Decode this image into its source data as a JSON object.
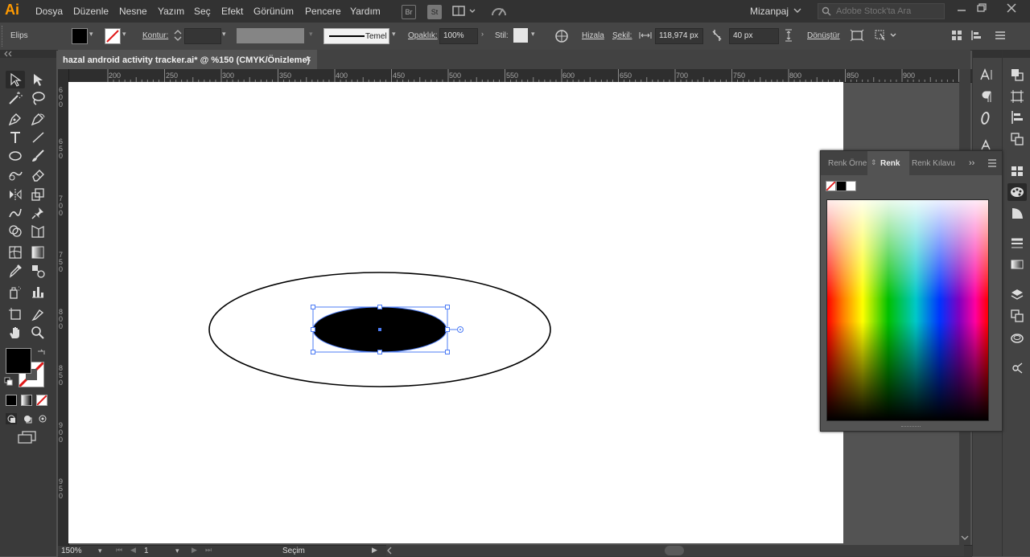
{
  "app": {
    "logo": "Ai"
  },
  "menu": [
    "Dosya",
    "Düzenle",
    "Nesne",
    "Yazım",
    "Seç",
    "Efekt",
    "Görünüm",
    "Pencere",
    "Yardım"
  ],
  "menubar_icons": {
    "br": "Br",
    "st": "St"
  },
  "workspace": "Mizanpaj",
  "search": {
    "placeholder": "Adobe Stock'ta Ara"
  },
  "control": {
    "object_type": "Elips",
    "stroke_label": "Kontur:",
    "brush_name": "Temel",
    "opacity_label": "Opaklık:",
    "opacity_value": "100%",
    "style_label": "Stil:",
    "align_label": "Hizala",
    "shape_label": "Şekil:",
    "width_value": "118,974 px",
    "corner_value": "40 px",
    "transform_label": "Dönüştür"
  },
  "document": {
    "tab_title": "hazal android activity tracker.ai* @ %150 (CMYK/Önizleme)",
    "close": "×"
  },
  "ruler": {
    "h_labels": [
      "200",
      "250",
      "300",
      "350",
      "400",
      "450",
      "500",
      "550",
      "600",
      "650",
      "700",
      "750",
      "800",
      "850",
      "900"
    ],
    "v_labels": [
      "600",
      "650",
      "700",
      "750",
      "800",
      "850",
      "900",
      "950"
    ]
  },
  "color_panel": {
    "tabs": [
      "Renk Örnek",
      "Renk",
      "Renk Kılavu"
    ],
    "active_tab": "Renk",
    "more": "››"
  },
  "status": {
    "zoom": "150%",
    "page": "1",
    "tool": "Seçim"
  },
  "colors": {
    "fill": "#000000",
    "selection": "#4d7cf5",
    "logo": "#ff9a00"
  }
}
